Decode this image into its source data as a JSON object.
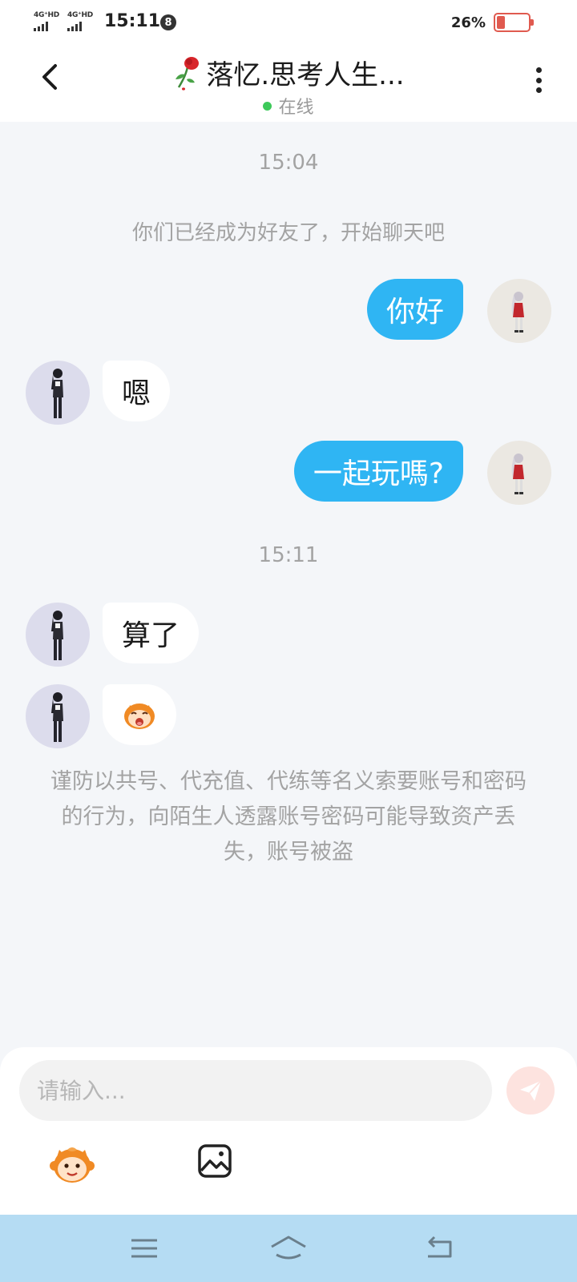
{
  "status_bar": {
    "network_1": "4G⁺HD",
    "network_2": "4G⁺HD",
    "time": "15:11",
    "notification_count": "8",
    "battery_percent": "26%",
    "battery_level": 0.26,
    "battery_color": "#e05a4f"
  },
  "header": {
    "back_icon": "chevron-left-icon",
    "title": "落忆.思考人生...",
    "title_icon": "wilted-rose-icon",
    "status": "在线",
    "status_color": "#3dc95a",
    "more_icon": "more-vertical-icon"
  },
  "chat": {
    "timestamp_1": "15:04",
    "system_note": "你们已经成为好友了，开始聊天吧",
    "messages": [
      {
        "direction": "out",
        "text": "你好"
      },
      {
        "direction": "in",
        "text": "嗯"
      },
      {
        "direction": "out",
        "text": "一起玩嗎?"
      },
      {
        "direction": "in",
        "text": "算了"
      },
      {
        "direction": "in",
        "text": "",
        "sticker": "yawning-monkey-sticker"
      }
    ],
    "timestamp_2": "15:11",
    "warning": "谨防以共号、代充值、代练等名义索要账号和密码的行为，向陌生人透露账号密码可能导致资产丢失，账号被盗",
    "outgoing_bubble_color": "#2fb5f3"
  },
  "input": {
    "placeholder": "请输入...",
    "send_icon": "paper-plane-icon",
    "emoji_icon": "monkey-emoji-icon",
    "image_icon": "image-icon"
  },
  "nav": {
    "menu_icon": "menu-icon",
    "home_icon": "home-icon",
    "back_icon": "back-arrow-icon"
  }
}
